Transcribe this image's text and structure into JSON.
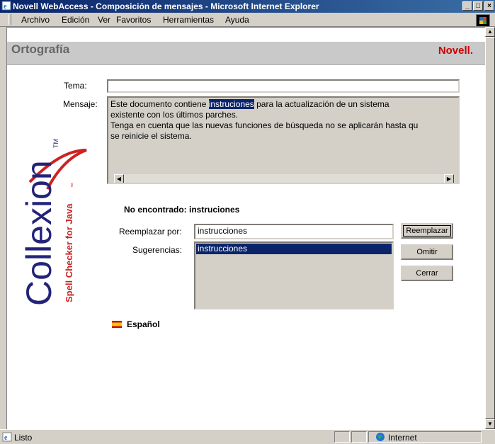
{
  "window": {
    "title": "Novell WebAccess - Composición de mensajes - Microsoft Internet Explorer",
    "min_label": "_",
    "max_label": "□",
    "close_label": "×"
  },
  "menu": [
    "Archivo",
    "Edición",
    "Ver",
    "Favoritos",
    "Herramientas",
    "Ayuda"
  ],
  "header": {
    "title": "Ortografía",
    "brand": "Novell."
  },
  "form": {
    "subject_label": "Tema:",
    "subject_value": "",
    "message_label": "Mensaje:",
    "message": {
      "before": "Este documento contiene ",
      "highlight": "instruciones",
      "after": " para la actualización de un sistema\nexistente con los últimos parches.\nTenga en cuenta que las nuevas funciones de búsqueda no se aplicarán hasta qu\nse reinicie el sistema."
    }
  },
  "spell": {
    "not_found": "No encontrado: instruciones",
    "replace_label": "Reemplazar por:",
    "replace_value": "instrucciones",
    "suggestions_label": "Sugerencias:",
    "suggestions": [
      "instrucciones"
    ],
    "replace_button": "Reemplazar",
    "skip_button": "Omitir",
    "close_button": "Cerrar",
    "language": "Español"
  },
  "sidebar_logo": {
    "brand": "Collexion",
    "tm": "TM",
    "tagline": "Spell Checker for Java",
    "tagline_tm": "™"
  },
  "status": {
    "text": "Listo",
    "zone": "Internet"
  },
  "colors": {
    "selection": "#0a246a",
    "brand_red": "#cc0000",
    "logo_blue": "#23237a"
  }
}
